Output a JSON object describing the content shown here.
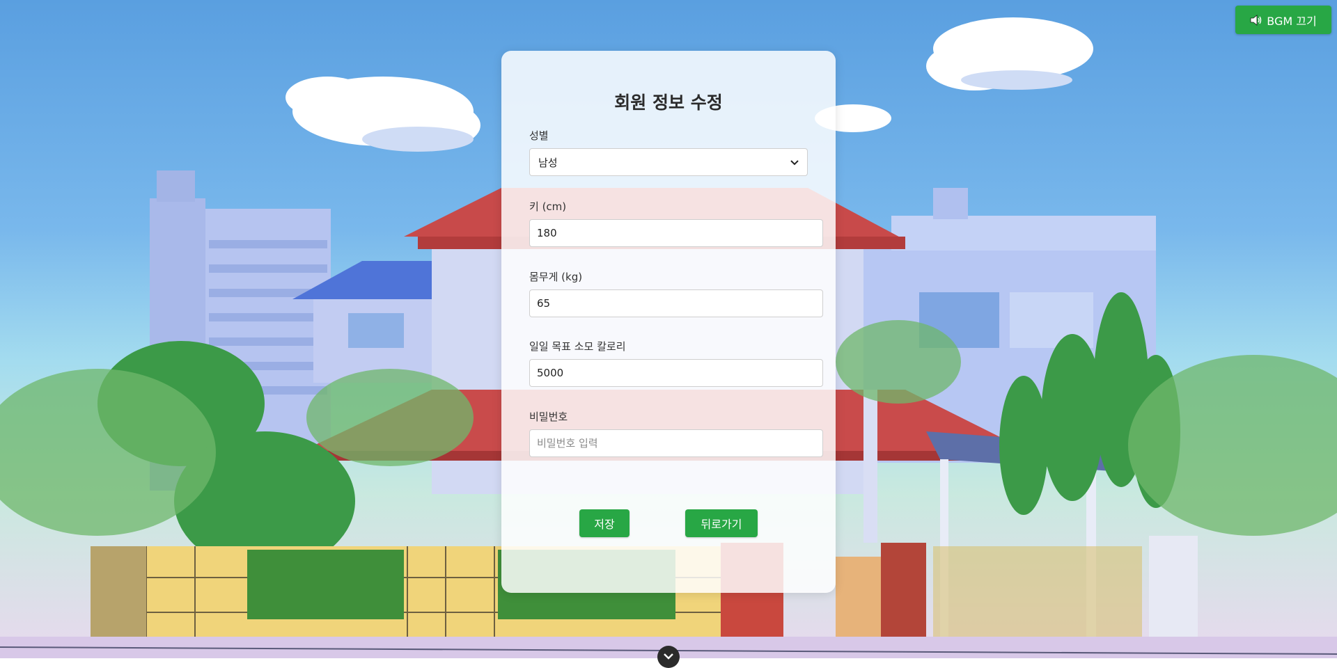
{
  "bgm": {
    "label": "BGM 끄기",
    "icon": "speaker-icon"
  },
  "form": {
    "title": "회원 정보 수정",
    "gender": {
      "label": "성별",
      "value": "남성"
    },
    "height": {
      "label": "키 (cm)",
      "value": "180"
    },
    "weight": {
      "label": "몸무게 (kg)",
      "value": "65"
    },
    "calories": {
      "label": "일일 목표 소모 칼로리",
      "value": "5000"
    },
    "password": {
      "label": "비밀번호",
      "placeholder": "비밀번호 입력",
      "value": ""
    }
  },
  "actions": {
    "save_label": "저장",
    "back_label": "뒤로가기"
  },
  "colors": {
    "accent": "#28a745",
    "sky": "#5aa0e0"
  },
  "scroll_handle_icon": "chevron-down-icon"
}
